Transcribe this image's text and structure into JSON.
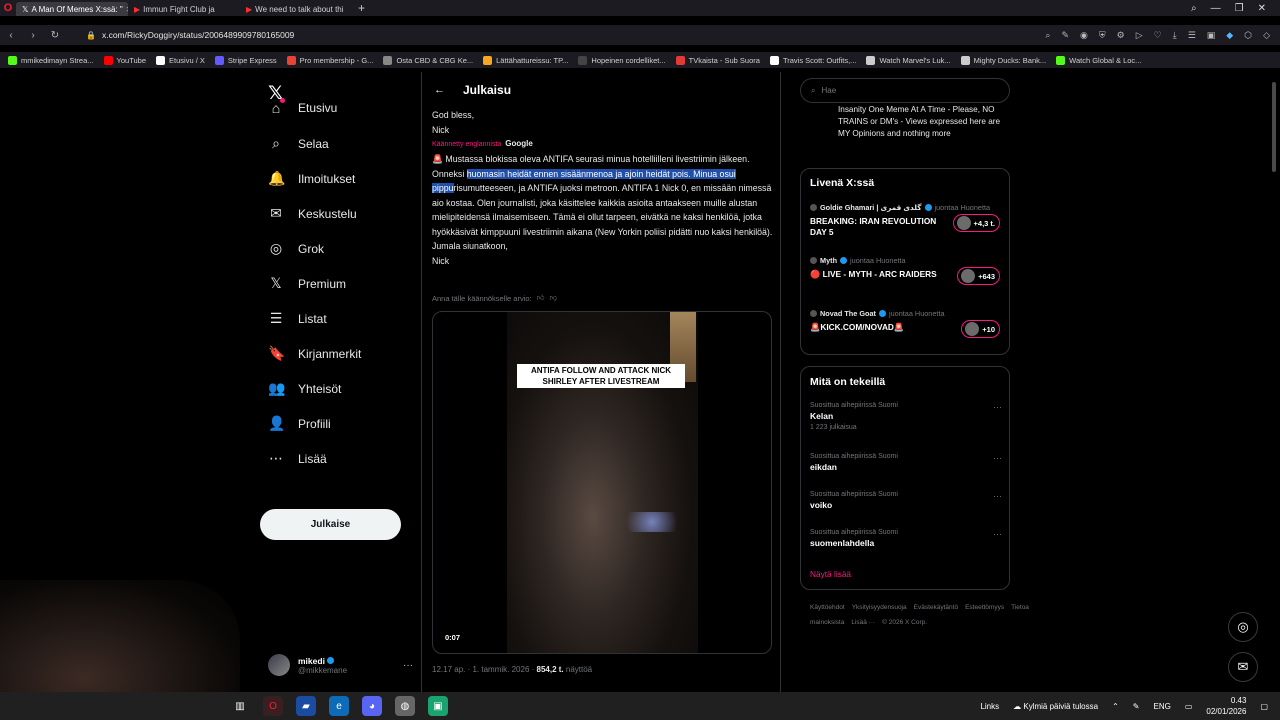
{
  "browser": {
    "tabs": [
      {
        "label": "A Man Of Memes X:ssä: \"",
        "icon": "𝕏"
      },
      {
        "label": "Immun Fight Club ja",
        "icon": "▶"
      },
      {
        "label": "We need to talk about thi",
        "icon": "▶"
      }
    ],
    "new_tab": "+",
    "url": "x.com/RickyDoggiry/status/2006489909780165009",
    "bookmarks": [
      {
        "label": "mmikedimayn Strea...",
        "color": "#53fc18"
      },
      {
        "label": "YouTube",
        "color": "#ff0000"
      },
      {
        "label": "Etusivu / X",
        "color": "#ffffff"
      },
      {
        "label": "Stripe Express",
        "color": "#635bff"
      },
      {
        "label": "Pro membership - G...",
        "color": "#ea4335"
      },
      {
        "label": "Osta CBD & CBG Ke...",
        "color": "#888888"
      },
      {
        "label": "Lättähattureissu: TP...",
        "color": "#f5a623"
      },
      {
        "label": "Hopeinen cordelliket...",
        "color": "#444444"
      },
      {
        "label": "TVkaista - Sub Suora",
        "color": "#e53935"
      },
      {
        "label": "Travis Scott: Outfits,...",
        "color": "#ffffff"
      },
      {
        "label": "Watch Marvel's Luk...",
        "color": "#cccccc"
      },
      {
        "label": "Mighty Ducks: Bank...",
        "color": "#cccccc"
      },
      {
        "label": "Watch Global & Loc...",
        "color": "#53fc18"
      }
    ]
  },
  "nav": {
    "items": [
      {
        "label": "Etusivu",
        "icon": "⌂",
        "name": "home"
      },
      {
        "label": "Selaa",
        "icon": "⌕",
        "name": "explore"
      },
      {
        "label": "Ilmoitukset",
        "icon": "🔔",
        "name": "notifications"
      },
      {
        "label": "Keskustelu",
        "icon": "✉",
        "name": "messages"
      },
      {
        "label": "Grok",
        "icon": "◎",
        "name": "grok"
      },
      {
        "label": "Premium",
        "icon": "𝕏",
        "name": "premium"
      },
      {
        "label": "Listat",
        "icon": "☰",
        "name": "lists"
      },
      {
        "label": "Kirjanmerkit",
        "icon": "🔖",
        "name": "bookmarks"
      },
      {
        "label": "Yhteisöt",
        "icon": "👥",
        "name": "communities"
      },
      {
        "label": "Profiili",
        "icon": "👤",
        "name": "profile"
      },
      {
        "label": "Lisää",
        "icon": "⋯",
        "name": "more"
      }
    ],
    "post_button": "Julkaise",
    "account": {
      "name": "mikedi",
      "handle": "@mikkemane",
      "more": "···"
    }
  },
  "post": {
    "header": "Julkaisu",
    "line_god": "God bless,",
    "line_nick": "Nick",
    "translated_label": "Käännetty englannista",
    "translated_by": "Google",
    "body_before": "🚨 Mustassa blokissa oleva ANTIFA seurasi minua hotelliilleni livestriimin jälkeen. Onneksi ",
    "body_highlight": "huomasin heidät ennen sisäänmenoa ja ajoin heidät pois. Minua osui pippu",
    "body_after": "risumutteeseen, ja ANTIFA juoksi metroon. ANTIFA 1 Nick 0, en missään nimessä aio kostaa. Olen journalisti, joka käsittelee kaikkia asioita antaakseen muille alustan mielipiteidensä ilmaisemiseen. Tämä ei ollut tarpeen, eivätkä ne kaksi henkilöä, jotka hyökkäsivät kimppuuni livestriimin aikana (New Yorkin poliisi pidätti nuo kaksi henkilöä).",
    "closing": "Jumala siunatkoon,",
    "signature": "Nick",
    "rate_prompt": "Anna tälle käännökselle arvio:",
    "video_caption": "ANTIFA FOLLOW AND ATTACK NICK SHIRLEY AFTER LIVESTREAM",
    "video_time": "0:07",
    "timestamp": "12.17 ap. · 1. tammik. 2026 ·",
    "views_count": "854,2 t.",
    "views_label": "näyttöä"
  },
  "right": {
    "search_placeholder": "Hae",
    "bio_snippet": "Insanity One Meme At A Time - Please, NO TRAINS or DM's - Views expressed here are MY Opinions and nothing more",
    "live_title": "Livenä X:ssä",
    "live": [
      {
        "user": "Goldie Ghamari | گلدی قمری",
        "status": "juontaa Huonetta",
        "title": "BREAKING: IRAN REVOLUTION DAY 5",
        "count": "+4,3 t."
      },
      {
        "user": "Myth",
        "status": "juontaa Huonetta",
        "title": "🔴 LIVE - MYTH - ARC RAIDERS",
        "count": "+643"
      },
      {
        "user": "Novad The Goat",
        "status": "juontaa Huonetta",
        "title": "🚨KICK.COM/NOVAD🚨",
        "count": "+10"
      }
    ],
    "trends_title": "Mitä on tekeillä",
    "trends": [
      {
        "context": "Suosittua aihepiirissä Suomi",
        "name": "Kelan",
        "count": "1 223 julkaisua"
      },
      {
        "context": "Suosittua aihepiirissä Suomi",
        "name": "eikdan",
        "count": ""
      },
      {
        "context": "Suosittua aihepiirissä Suomi",
        "name": "voiko",
        "count": ""
      },
      {
        "context": "Suosittua aihepiirissä Suomi",
        "name": "suomenlahdella",
        "count": ""
      }
    ],
    "trend_more": "···",
    "show_more": "Näytä lisää",
    "footer": [
      "Käyttöehdot",
      "Yksityisyydensuoja",
      "Evästekäytäntö",
      "Esteettömyys",
      "Tietoa mainoksista",
      "Lisää ···",
      "© 2026 X Corp."
    ]
  },
  "taskbar": {
    "links": "Links",
    "weather": "Kylmiä päiviä tulossa",
    "lang": "ENG",
    "time": "0.43",
    "date": "02/01/2026"
  }
}
